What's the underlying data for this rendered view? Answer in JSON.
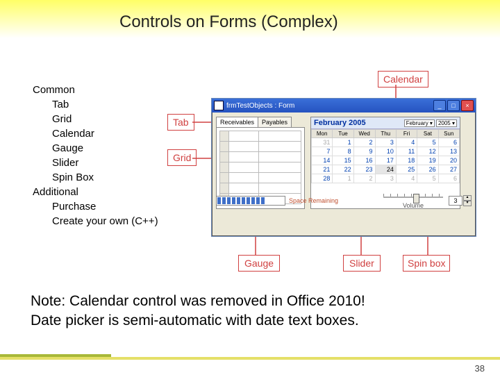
{
  "title": "Controls on Forms (Complex)",
  "outline": {
    "common": "Common",
    "items": [
      "Tab",
      "Grid",
      "Calendar",
      "Gauge",
      "Slider",
      "Spin Box"
    ],
    "additional": "Additional",
    "add_items": [
      "Purchase",
      "Create your own (C++)"
    ]
  },
  "labels": {
    "calendar": "Calendar",
    "tab": "Tab",
    "grid": "Grid",
    "gauge": "Gauge",
    "slider": "Slider",
    "spinbox": "Spin box"
  },
  "form": {
    "window_title": "frmTestObjects : Form",
    "tabs": [
      "Receivables",
      "Payables"
    ],
    "calendar": {
      "month": "February 2005",
      "month_sel": "February",
      "year_sel": "2005",
      "dow": [
        "Mon",
        "Tue",
        "Wed",
        "Thu",
        "Fri",
        "Sat",
        "Sun"
      ],
      "rows": [
        [
          "31",
          "1",
          "2",
          "3",
          "4",
          "5",
          "6"
        ],
        [
          "7",
          "8",
          "9",
          "10",
          "11",
          "12",
          "13"
        ],
        [
          "14",
          "15",
          "16",
          "17",
          "18",
          "19",
          "20"
        ],
        [
          "21",
          "22",
          "23",
          "24",
          "25",
          "26",
          "27"
        ],
        [
          "28",
          "1",
          "2",
          "3",
          "4",
          "5",
          "6"
        ]
      ]
    },
    "gauge_label": "Space Remaining",
    "slider_label": "Volume",
    "spin_value": "3"
  },
  "note_line1": "Note: Calendar control was removed in Office 2010!",
  "note_line2": "Date picker is semi-automatic with date text boxes.",
  "page": "38"
}
